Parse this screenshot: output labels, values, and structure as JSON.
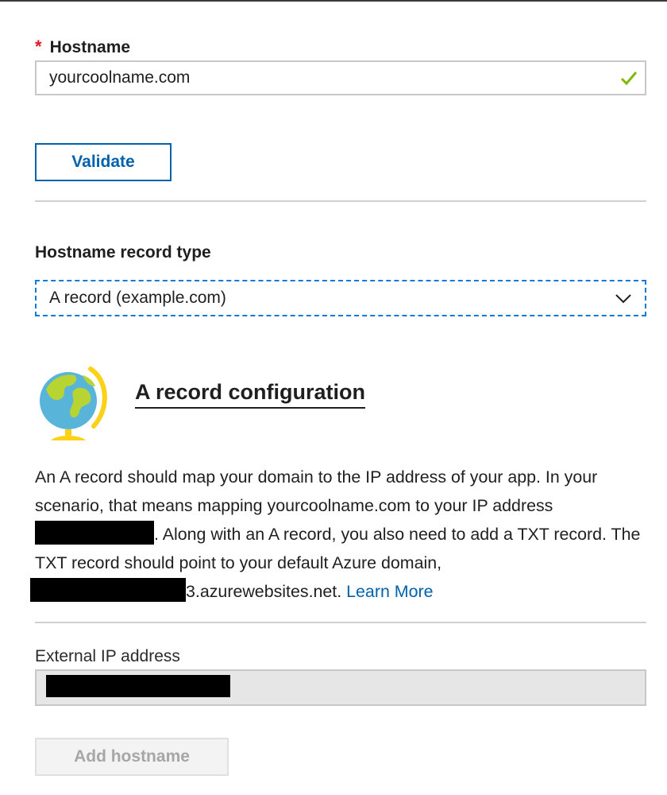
{
  "hostname": {
    "label": "Hostname",
    "required_marker": "*",
    "value": "yourcoolname.com",
    "status_icon": "checkmark-icon",
    "status_color": "#7fba00"
  },
  "validate_button": "Validate",
  "record_type": {
    "label": "Hostname record type",
    "selected": "A record (example.com)"
  },
  "config": {
    "icon": "globe-icon",
    "title": "A record configuration",
    "desc_part1": "An A record should map your domain to the IP address of your app. In your scenario, that means mapping yourcoolname.com to your IP address ",
    "desc_part2": ". Along with an A record, you also need to add a TXT record. The TXT record should point to your default Azure domain,",
    "desc_part3": "3.azurewebsites.net. ",
    "learn_more": "Learn More"
  },
  "external_ip": {
    "label": "External IP address"
  },
  "add_button": "Add hostname",
  "colors": {
    "accent": "#0062ad",
    "required": "#e81123",
    "focus_border": "#0f7ad8"
  }
}
